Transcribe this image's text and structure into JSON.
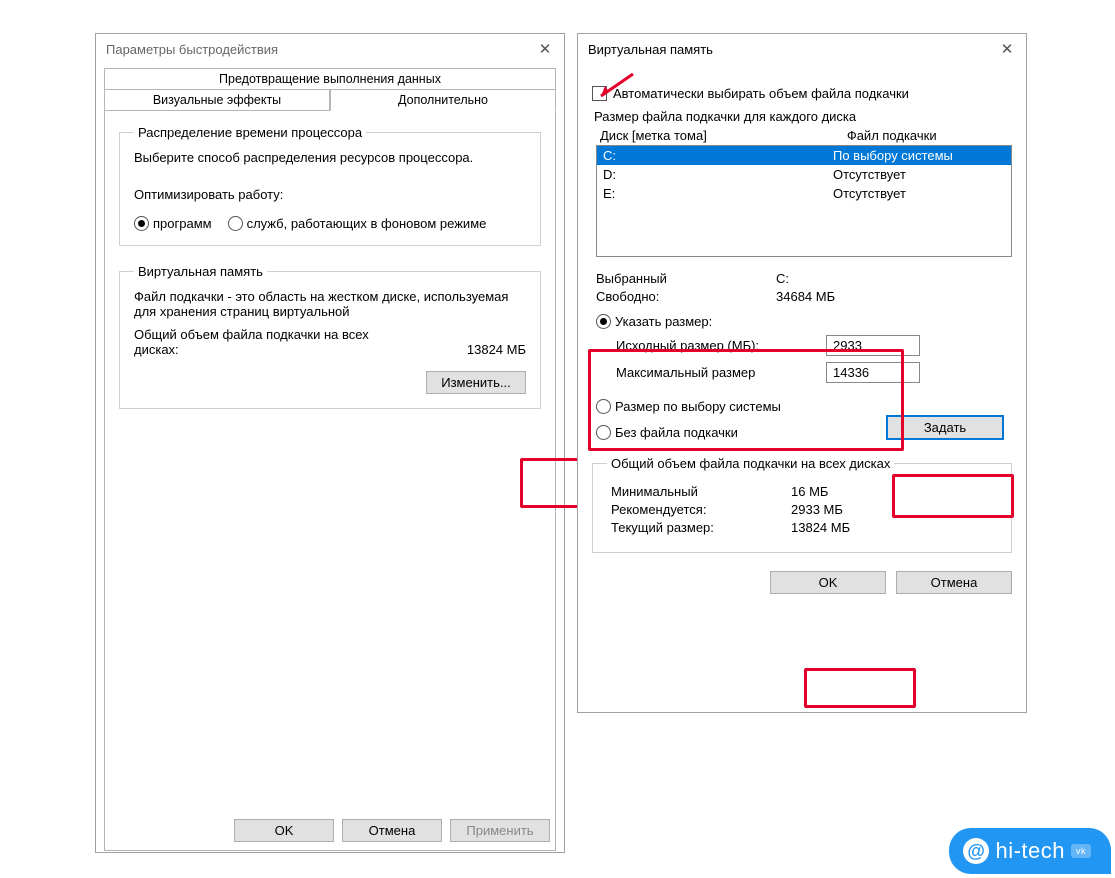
{
  "left_window": {
    "title": "Параметры быстродействия",
    "tabs": {
      "top": "Предотвращение выполнения данных",
      "left": "Визуальные эффекты",
      "right": "Дополнительно"
    },
    "cpu_group": {
      "legend": "Распределение времени процессора",
      "desc": "Выберите способ распределения ресурсов процессора.",
      "opt_label": "Оптимизировать работу:",
      "r1": "программ",
      "r2": "служб, работающих в фоновом режиме"
    },
    "vm_group": {
      "legend": "Виртуальная память",
      "desc": "Файл подкачки - это область на жестком диске, используемая для хранения страниц виртуальной",
      "total_label": "Общий объем файла подкачки на всех дисках:",
      "total_value": "13824 МБ",
      "change_btn": "Изменить..."
    },
    "buttons": {
      "ok": "OK",
      "cancel": "Отмена",
      "apply": "Применить"
    }
  },
  "right_window": {
    "title": "Виртуальная память",
    "auto_checkbox": "Автоматически выбирать объем файла подкачки",
    "per_drive_label": "Размер файла подкачки для каждого диска",
    "col1": "Диск [метка тома]",
    "col2": "Файл подкачки",
    "drives": [
      {
        "name": "C:",
        "status": "По выбору системы",
        "selected": true
      },
      {
        "name": "D:",
        "status": "Отсутствует",
        "selected": false
      },
      {
        "name": "E:",
        "status": "Отсутствует",
        "selected": false
      }
    ],
    "selected_label": "Выбранный",
    "selected_drive": "C:",
    "free_label": "Свободно:",
    "free_value": "34684 МБ",
    "custom_radio": "Указать размер:",
    "initial_label": "Исходный размер (МБ):",
    "initial_value": "2933",
    "max_label": "Максимальный размер",
    "max_value": "14336",
    "system_radio": "Размер по выбору системы",
    "none_radio": "Без файла подкачки",
    "set_btn": "Задать",
    "totals_group": {
      "legend": "Общий объем файла подкачки на всех дисках",
      "min_label": "Минимальный",
      "min_value": "16 МБ",
      "rec_label": "Рекомендуется:",
      "rec_value": "2933 МБ",
      "cur_label": "Текущий размер:",
      "cur_value": "13824 МБ"
    },
    "buttons": {
      "ok": "OK",
      "cancel": "Отмена"
    }
  },
  "watermark": "hi-tech"
}
